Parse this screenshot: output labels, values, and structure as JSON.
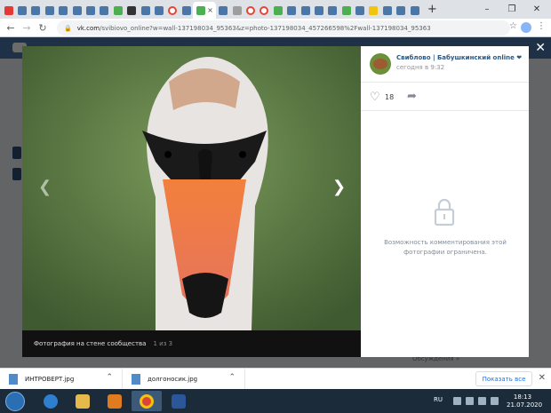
{
  "browser": {
    "tabs": [
      {
        "icon": "youtube-icon",
        "color": "#e53935"
      },
      {
        "icon": "vk-icon",
        "color": "#4a76a8"
      },
      {
        "icon": "vk-icon",
        "color": "#4a76a8"
      },
      {
        "icon": "vk-icon",
        "color": "#4a76a8"
      },
      {
        "icon": "vk-icon",
        "color": "#4a76a8"
      },
      {
        "icon": "vk-icon",
        "color": "#4a76a8"
      },
      {
        "icon": "vk-icon",
        "color": "#4a76a8"
      },
      {
        "icon": "vk-icon",
        "color": "#4a76a8"
      },
      {
        "icon": "green-icon",
        "color": "#4caf50"
      },
      {
        "icon": "dark-icon",
        "color": "#333333"
      },
      {
        "icon": "vk-icon",
        "color": "#4a76a8"
      },
      {
        "icon": "vk-icon",
        "color": "#4a76a8"
      },
      {
        "icon": "google-icon",
        "color": "#ea4335"
      },
      {
        "icon": "vk-icon",
        "color": "#4a76a8"
      },
      {
        "icon": "green-icon",
        "color": "#4caf50"
      },
      {
        "icon": "vk-icon",
        "color": "#4a76a8"
      },
      {
        "icon": "gray-icon",
        "color": "#9e9e9e"
      },
      {
        "icon": "google-icon",
        "color": "#ea4335"
      },
      {
        "icon": "google-icon",
        "color": "#ea4335"
      },
      {
        "icon": "green-icon",
        "color": "#4caf50"
      },
      {
        "icon": "vk-icon",
        "color": "#4a76a8"
      },
      {
        "icon": "vk-icon",
        "color": "#4a76a8"
      },
      {
        "icon": "vk-icon",
        "color": "#4a76a8"
      },
      {
        "icon": "vk-icon",
        "color": "#4a76a8"
      },
      {
        "icon": "green-icon",
        "color": "#4caf50"
      },
      {
        "icon": "vk-icon",
        "color": "#4a76a8"
      },
      {
        "icon": "yellow-icon",
        "color": "#f1c40f"
      },
      {
        "icon": "vk-icon",
        "color": "#4a76a8"
      },
      {
        "icon": "vk-icon",
        "color": "#4a76a8"
      },
      {
        "icon": "vk-icon",
        "color": "#4a76a8"
      }
    ],
    "active_tab_close": "×",
    "new_tab": "+",
    "url_host": "vk.com",
    "url_rest": "/svibiovo_online?w=wall-137198034_95363&z=photo-137198034_457266598%2Fwall-137198034_95363"
  },
  "viewer": {
    "author": "Свиблово | Бабушкинский online ❤",
    "time": "сегодня в 9:32",
    "likes": "18",
    "caption": "Фотография на стене сообщества",
    "counter": "1 из 3",
    "restriction": "Возможность комментирования этой фотографии ограничена."
  },
  "page_behind": {
    "hint": "Обсуждения »"
  },
  "downloads": {
    "items": [
      {
        "name": "ИНТРОВЕРТ.jpg"
      },
      {
        "name": "долгоносик.jpg"
      }
    ],
    "show_all": "Показать все"
  },
  "taskbar": {
    "lang": "RU",
    "time": "18:13",
    "date": "21.07.2020"
  }
}
